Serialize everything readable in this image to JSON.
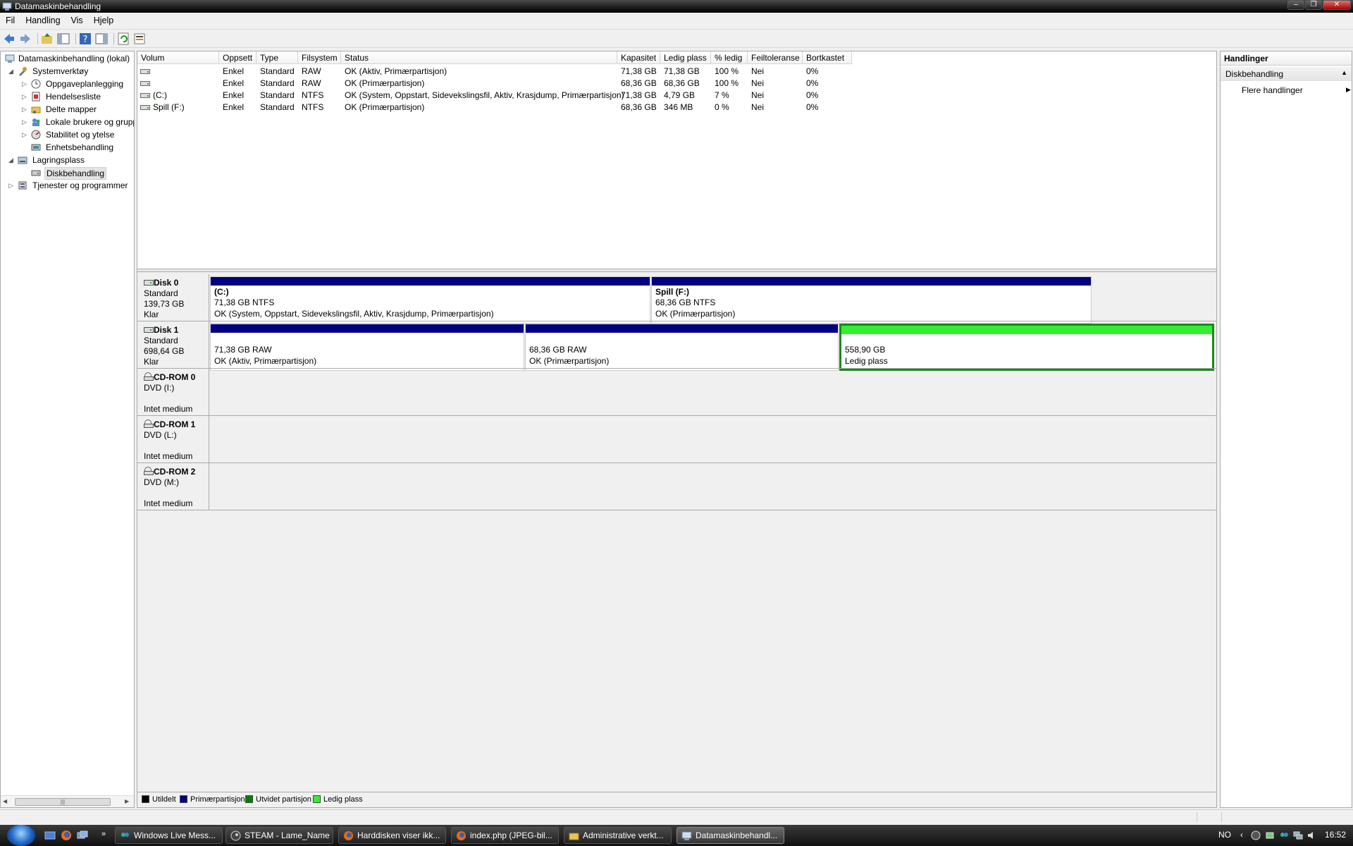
{
  "window": {
    "title": "Datamaskinbehandling"
  },
  "menu": [
    "Fil",
    "Handling",
    "Vis",
    "Hjelp"
  ],
  "tree": [
    {
      "label": "Datamaskinbehandling (lokal)",
      "level": 0,
      "expander": "",
      "icon": "computer-management-icon"
    },
    {
      "label": "Systemverktøy",
      "level": 1,
      "expander": "◢",
      "icon": "tools-icon"
    },
    {
      "label": "Oppgaveplanlegging",
      "level": 2,
      "expander": "▷",
      "icon": "clock-icon"
    },
    {
      "label": "Hendelsesliste",
      "level": 2,
      "expander": "▷",
      "icon": "event-viewer-icon"
    },
    {
      "label": "Delte mapper",
      "level": 2,
      "expander": "▷",
      "icon": "shared-folder-icon"
    },
    {
      "label": "Lokale brukere og grupper",
      "level": 2,
      "expander": "▷",
      "icon": "users-icon"
    },
    {
      "label": "Stabilitet og ytelse",
      "level": 2,
      "expander": "▷",
      "icon": "performance-icon"
    },
    {
      "label": "Enhetsbehandling",
      "level": 2,
      "expander": "",
      "icon": "device-manager-icon"
    },
    {
      "label": "Lagringsplass",
      "level": 1,
      "expander": "◢",
      "icon": "storage-icon"
    },
    {
      "label": "Diskbehandling",
      "level": 2,
      "expander": "",
      "icon": "disk-management-icon",
      "selected": true
    },
    {
      "label": "Tjenester og programmer",
      "level": 1,
      "expander": "▷",
      "icon": "services-icon"
    }
  ],
  "volume_columns": [
    "Volum",
    "Oppsett",
    "Type",
    "Filsystem",
    "Status",
    "Kapasitet",
    "Ledig plass",
    "% ledig",
    "Feiltoleranse",
    "Bortkastet"
  ],
  "volumes": [
    [
      "",
      "Enkel",
      "Standard",
      "RAW",
      "OK (Aktiv, Primærpartisjon)",
      "71,38 GB",
      "71,38 GB",
      "100 %",
      "Nei",
      "0%"
    ],
    [
      "",
      "Enkel",
      "Standard",
      "RAW",
      "OK (Primærpartisjon)",
      "68,36 GB",
      "68,36 GB",
      "100 %",
      "Nei",
      "0%"
    ],
    [
      "(C:)",
      "Enkel",
      "Standard",
      "NTFS",
      "OK (System, Oppstart, Sidevekslingsfil, Aktiv, Krasjdump, Primærpartisjon)",
      "71,38 GB",
      "4,79 GB",
      "7 %",
      "Nei",
      "0%"
    ],
    [
      "Spill (F:)",
      "Enkel",
      "Standard",
      "NTFS",
      "OK (Primærpartisjon)",
      "68,36 GB",
      "346 MB",
      "0 %",
      "Nei",
      "0%"
    ]
  ],
  "disks": [
    {
      "name": "Disk 0",
      "type": "Standard",
      "size": "139,73 GB",
      "state": "Klar",
      "partitions": [
        {
          "title": "(C:)",
          "size": "71,38 GB NTFS",
          "status": "OK (System, Oppstart, Sidevekslingsfil, Aktiv, Krasjdump, Primærpartisjon)"
        },
        {
          "title": "Spill  (F:)",
          "size": "68,36 GB NTFS",
          "status": "OK (Primærpartisjon)"
        }
      ]
    },
    {
      "name": "Disk 1",
      "type": "Standard",
      "size": "698,64 GB",
      "state": "Klar",
      "partitions": [
        {
          "title": "",
          "size": "71,38 GB RAW",
          "status": "OK (Aktiv, Primærpartisjon)"
        },
        {
          "title": "",
          "size": "68,36 GB RAW",
          "status": "OK (Primærpartisjon)"
        },
        {
          "title": "",
          "size": "558,90 GB",
          "status": "Ledig plass"
        }
      ]
    }
  ],
  "cdroms": [
    {
      "name": "CD-ROM 0",
      "drive": "DVD (I:)",
      "state": "Intet medium"
    },
    {
      "name": "CD-ROM 1",
      "drive": "DVD (L:)",
      "state": "Intet medium"
    },
    {
      "name": "CD-ROM 2",
      "drive": "DVD (M:)",
      "state": "Intet medium"
    }
  ],
  "legend": [
    {
      "label": "Utildelt",
      "color": "#000000"
    },
    {
      "label": "Primærpartisjon",
      "color": "#000080"
    },
    {
      "label": "Utvidet partisjon",
      "color": "#008000"
    },
    {
      "label": "Ledig plass",
      "color": "#33ee33"
    }
  ],
  "actions": {
    "header": "Handlinger",
    "section": "Diskbehandling",
    "item": "Flere handlinger"
  },
  "taskbar": {
    "tasks": [
      {
        "label": "Windows Live Mess...",
        "icon": "messenger-icon"
      },
      {
        "label": "STEAM - Lame_Name",
        "icon": "steam-icon"
      },
      {
        "label": "Harddisken viser ikk...",
        "icon": "firefox-icon"
      },
      {
        "label": "index.php (JPEG-bil...",
        "icon": "firefox-icon"
      },
      {
        "label": "Administrative verkt...",
        "icon": "folder-icon"
      },
      {
        "label": "Datamaskinbehandl...",
        "icon": "computer-management-icon",
        "active": true
      }
    ],
    "language": "NO",
    "clock": "16:52"
  },
  "colors": {
    "primary_partition": "#000080",
    "free_space": "#33ee33",
    "free_space_border": "#1a8a1a"
  }
}
